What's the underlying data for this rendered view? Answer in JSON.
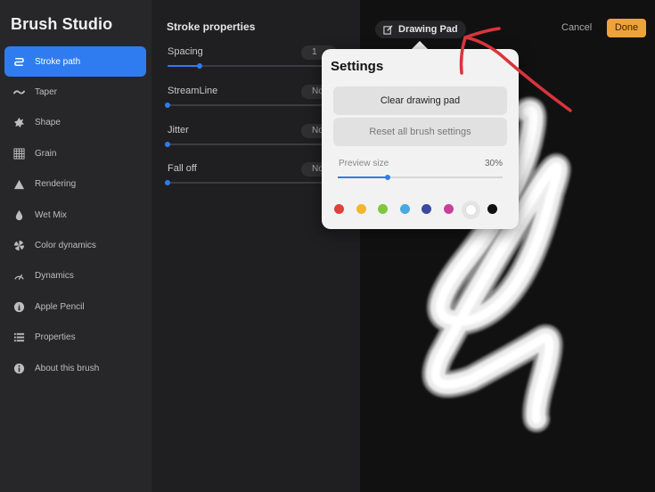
{
  "app": {
    "title": "Brush Studio"
  },
  "sidebar": {
    "items": [
      {
        "label": "Stroke path",
        "icon": "stroke-path-icon",
        "active": true
      },
      {
        "label": "Taper",
        "icon": "taper-icon"
      },
      {
        "label": "Shape",
        "icon": "shape-icon"
      },
      {
        "label": "Grain",
        "icon": "grain-icon"
      },
      {
        "label": "Rendering",
        "icon": "rendering-icon"
      },
      {
        "label": "Wet Mix",
        "icon": "wet-mix-icon"
      },
      {
        "label": "Color dynamics",
        "icon": "color-dynamics-icon"
      },
      {
        "label": "Dynamics",
        "icon": "dynamics-icon"
      },
      {
        "label": "Apple Pencil",
        "icon": "apple-pencil-icon"
      },
      {
        "label": "Properties",
        "icon": "properties-icon"
      },
      {
        "label": "About this brush",
        "icon": "info-icon"
      }
    ]
  },
  "panel": {
    "title": "Stroke properties",
    "properties": [
      {
        "label": "Spacing",
        "value": "1",
        "level": 0.18
      },
      {
        "label": "StreamLine",
        "value": "No",
        "level": 0
      },
      {
        "label": "Jitter",
        "value": "No",
        "level": 0
      },
      {
        "label": "Fall off",
        "value": "No",
        "level": 0
      }
    ]
  },
  "header": {
    "drawing_pad_label": "Drawing Pad",
    "cancel_label": "Cancel",
    "done_label": "Done"
  },
  "settings_popup": {
    "title": "Settings",
    "clear_label": "Clear drawing pad",
    "reset_label": "Reset all brush settings",
    "preview_size_label": "Preview size",
    "preview_size_value": "30%",
    "preview_size_level": 0.3,
    "colors": [
      "#e0403a",
      "#f2b630",
      "#7ec83c",
      "#4aa7e0",
      "#3b4aa0",
      "#c8409a",
      "#ffffff",
      "#111111"
    ],
    "selected_color_index": 6
  },
  "colors": {
    "accent": "#2f7cf0",
    "done_button": "#f0a23a",
    "annotation_arrow": "#d8353b"
  }
}
